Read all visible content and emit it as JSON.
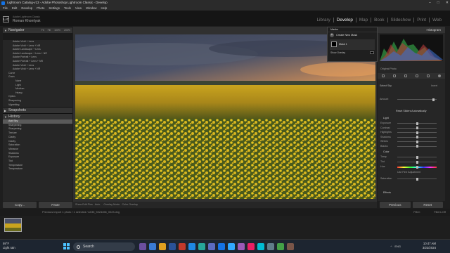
{
  "window": {
    "title": "Lightroom Catalog-v13 - Adobe Photoshop Lightroom Classic - Develop",
    "controls": [
      "–",
      "□",
      "✕"
    ]
  },
  "menu": [
    "File",
    "Edit",
    "Develop",
    "Photo",
    "Settings",
    "Tools",
    "View",
    "Window",
    "Help"
  ],
  "identity": {
    "logo": "LrC",
    "owner": "Adobe Lightroom Classic",
    "user": "Roman Khomlyak"
  },
  "modules": [
    {
      "label": "Library",
      "active": false
    },
    {
      "label": "Develop",
      "active": true
    },
    {
      "label": "Map",
      "active": false
    },
    {
      "label": "Book",
      "active": false
    },
    {
      "label": "Slideshow",
      "active": false
    },
    {
      "label": "Print",
      "active": false
    },
    {
      "label": "Web",
      "active": false
    }
  ],
  "left": {
    "navigator": {
      "label": "Navigator",
      "zoom": [
        "Fit",
        "Fill",
        "100%",
        "200%"
      ]
    },
    "presets": [
      {
        "label": "Adobe Vivid + Lens",
        "level": "sub"
      },
      {
        "label": "Adobe Vivid + Lens + NR",
        "level": "sub"
      },
      {
        "label": "Adobe Landscape + Lens",
        "level": "sub"
      },
      {
        "label": "Adobe Landscape + Lens + NR",
        "level": "sub"
      },
      {
        "label": "Adobe Portrait + Lens",
        "level": "sub"
      },
      {
        "label": "Adobe Portrait + Lens + NR",
        "level": "sub"
      },
      {
        "label": "Adobe Vivid + Lens",
        "level": "sub"
      },
      {
        "label": "Adobe Vivid + Lens + NR",
        "level": "sub"
      },
      {
        "label": "Curve",
        "level": "top"
      },
      {
        "label": "Grain",
        "level": "top"
      },
      {
        "label": "None",
        "level": "deep"
      },
      {
        "label": "Light",
        "level": "deep"
      },
      {
        "label": "Medium",
        "level": "deep"
      },
      {
        "label": "Heavy",
        "level": "deep"
      },
      {
        "label": "Optics",
        "level": "top"
      },
      {
        "label": "Sharpening",
        "level": "top"
      },
      {
        "label": "Vignetting",
        "level": "top"
      }
    ],
    "snapshots": "Snapshots",
    "history": {
      "label": "History",
      "items": [
        {
          "label": "Add Sky",
          "sel": true
        },
        {
          "label": "Sharpening",
          "sel": false
        },
        {
          "label": "Sharpening",
          "sel": false
        },
        {
          "label": "Texture",
          "sel": false
        },
        {
          "label": "Clarity",
          "sel": false
        },
        {
          "label": "Clarity",
          "sel": false
        },
        {
          "label": "Saturation",
          "sel": false
        },
        {
          "label": "Vibrance",
          "sel": false
        },
        {
          "label": "Shadows",
          "sel": false
        },
        {
          "label": "Exposure",
          "sel": false
        },
        {
          "label": "Tint",
          "sel": false
        },
        {
          "label": "Temperature",
          "sel": false
        },
        {
          "label": "Temperature",
          "sel": false
        }
      ]
    },
    "copy_label": "Copy...",
    "paste_label": "Paste"
  },
  "masks": {
    "header": "Masks",
    "create_new": "Create New Mask",
    "mask_name": "Mask 1",
    "show_overlay": "Show Overlay"
  },
  "center_toolbar": {
    "items": [
      "Show Edit Pins",
      "Auto",
      "Overlay Mode",
      "Color Overlay"
    ]
  },
  "right": {
    "histogram": "Histogram",
    "original_photo": "Original Photo",
    "sky_label": "Select Sky",
    "invert": "Invert",
    "amount": "Amount",
    "reset_label": "Reset Sliders Automatically",
    "light": "Light",
    "sliders_light": [
      "Exposure",
      "Contrast",
      "Highlights",
      "Shadows",
      "Whites",
      "Blacks"
    ],
    "color": "Color",
    "sliders_color": [
      "Temp",
      "Tint",
      "Hue"
    ],
    "fine": "Use Fine Adjustment",
    "sat": "Saturation",
    "effects": "Effects",
    "previous_label": "Previous",
    "reset_btn": "Reset"
  },
  "filmbar": {
    "text": "Previous Import   1 photo / 1 selected / A035_5024456_0023.dng",
    "filter": "Filter:",
    "filter_value": "Filters Off"
  },
  "taskbar": {
    "weather_temp": "59°F",
    "weather_desc": "Light rain",
    "search": "Search",
    "lang": "ENG",
    "time": "10:47 AM",
    "date": "3/22/2024"
  }
}
